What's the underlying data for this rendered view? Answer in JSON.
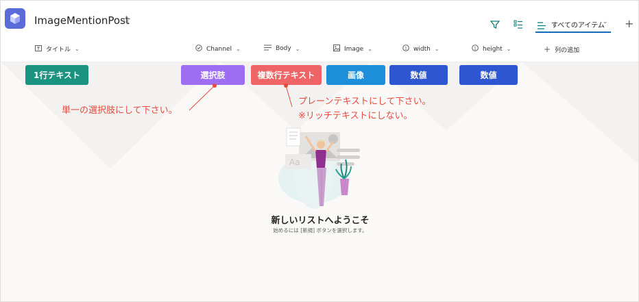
{
  "app": {
    "title": "ImageMentionPost"
  },
  "toolbar": {
    "view_label": "すべてのアイテム"
  },
  "columns": [
    {
      "label": "タイトル",
      "icon": "text-icon"
    },
    {
      "label": "Channel",
      "icon": "choice-icon"
    },
    {
      "label": "Body",
      "icon": "multiline-text-icon"
    },
    {
      "label": "Image",
      "icon": "image-icon"
    },
    {
      "label": "width",
      "icon": "number-icon"
    },
    {
      "label": "height",
      "icon": "number-icon"
    }
  ],
  "add_column_label": "列の追加",
  "tags": [
    {
      "text": "1行テキスト",
      "color": "#1a9381"
    },
    {
      "text": "選択肢",
      "color": "#9d6df2"
    },
    {
      "text": "複数行テキスト",
      "color": "#ef6464"
    },
    {
      "text": "画像",
      "color": "#1d8ed9"
    },
    {
      "text": "数値",
      "color": "#2f56d1"
    },
    {
      "text": "数値",
      "color": "#2f56d1"
    }
  ],
  "annotations": {
    "choice_note": "単一の選択肢にして下さい。",
    "body_note_1": "プレーンテキストにして下さい。",
    "body_note_2": "※リッチテキストにしない。",
    "color": "#e8483a"
  },
  "empty_state": {
    "title": "新しいリストへようこそ",
    "subtitle": "始めるには [新規] ボタンを選択します。"
  }
}
